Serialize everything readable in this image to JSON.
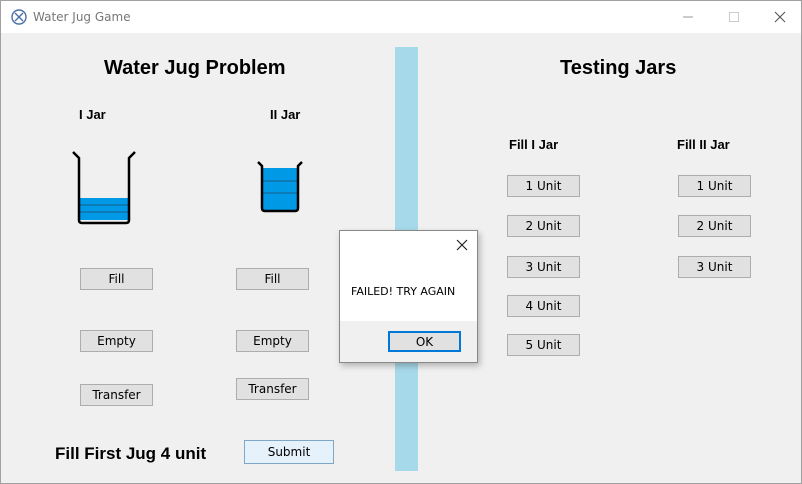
{
  "window": {
    "title": "Water Jug Game"
  },
  "left": {
    "heading": "Water Jug Problem",
    "jar1_label": "I Jar",
    "jar2_label": "II Jar",
    "jar1_buttons": {
      "fill": "Fill",
      "empty": "Empty",
      "transfer": "Transfer"
    },
    "jar2_buttons": {
      "fill": "Fill",
      "empty": "Empty",
      "transfer": "Transfer"
    },
    "goal": "Fill First Jug 4 unit",
    "submit": "Submit"
  },
  "right": {
    "heading": "Testing Jars",
    "fill1_label": "Fill I Jar",
    "fill2_label": "Fill II Jar",
    "fill1_buttons": [
      "1 Unit",
      "2 Unit",
      "3 Unit",
      "4 Unit",
      "5 Unit"
    ],
    "fill2_buttons": [
      "1 Unit",
      "2 Unit",
      "3 Unit"
    ]
  },
  "dialog": {
    "message": "FAILED! TRY AGAIN",
    "ok": "OK"
  },
  "colors": {
    "water": "#0099e6",
    "divider": "#a6d9e9",
    "accent": "#0078d7"
  }
}
